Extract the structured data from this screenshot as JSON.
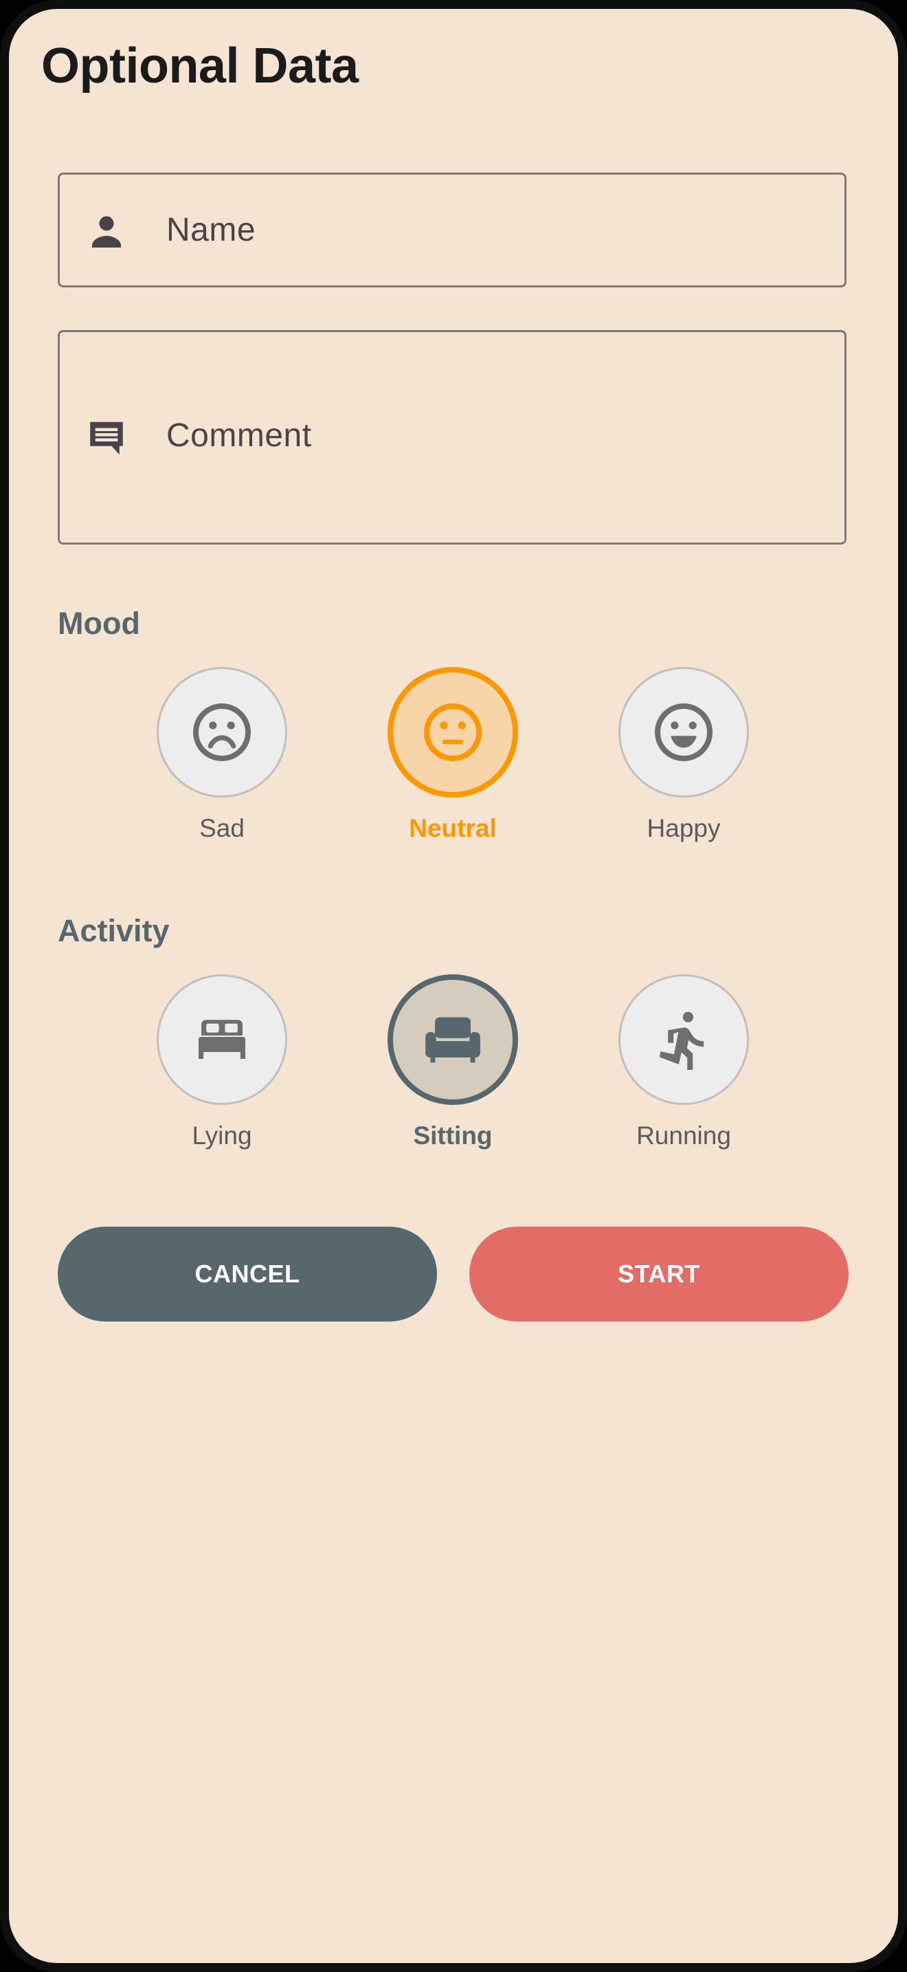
{
  "page": {
    "title": "Optional Data"
  },
  "form": {
    "name": {
      "placeholder": "Name",
      "icon": "person-icon"
    },
    "comment": {
      "placeholder": "Comment",
      "icon": "comment-icon"
    }
  },
  "mood": {
    "label": "Mood",
    "selected": "Neutral",
    "options": [
      {
        "label": "Sad",
        "icon": "sad-face-icon"
      },
      {
        "label": "Neutral",
        "icon": "neutral-face-icon"
      },
      {
        "label": "Happy",
        "icon": "happy-face-icon"
      }
    ]
  },
  "activity": {
    "label": "Activity",
    "selected": "Sitting",
    "options": [
      {
        "label": "Lying",
        "icon": "bed-icon"
      },
      {
        "label": "Sitting",
        "icon": "armchair-icon"
      },
      {
        "label": "Running",
        "icon": "running-person-icon"
      }
    ]
  },
  "actions": {
    "cancel": "CANCEL",
    "start": "START"
  },
  "colors": {
    "background": "#f4e4d1",
    "mood_accent": "#ff9800",
    "activity_accent": "#56676d",
    "cancel_button": "#56686e",
    "start_button": "#e36d66"
  }
}
